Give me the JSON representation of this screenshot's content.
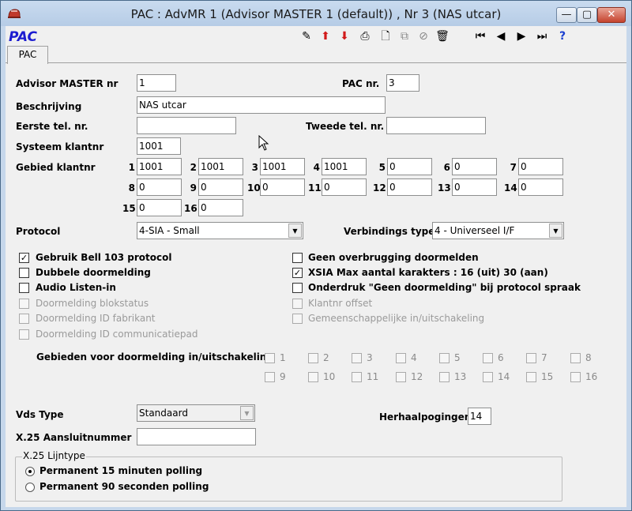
{
  "window": {
    "title": "PAC : AdvMR 1 (Advisor MASTER 1 (default)) , Nr 3 (NAS utcar)",
    "min_glyph": "—",
    "max_glyph": "▢",
    "close_glyph": "✕"
  },
  "app_logo": "PAC",
  "toolbar": {
    "icons": [
      "edit-icon",
      "up-arrow-icon",
      "down-arrow-icon",
      "print-icon",
      "new-doc-icon",
      "copy-icon",
      "cancel-icon",
      "delete-icon",
      "first-icon",
      "previous-icon",
      "next-icon",
      "last-icon",
      "help-icon"
    ],
    "glyphs": [
      "✎",
      "⬆",
      "⬇",
      "⎙",
      "🗋",
      "⧉",
      "⊘",
      "🗑",
      "⏮",
      "◀",
      "▶",
      "⏭",
      "?"
    ]
  },
  "tab": {
    "label": "PAC"
  },
  "form": {
    "advisor_master_nr_label": "Advisor MASTER nr",
    "advisor_master_nr": "1",
    "pac_nr_label": "PAC nr.",
    "pac_nr": "3",
    "beschrijving_label": "Beschrijving",
    "beschrijving": "NAS utcar",
    "eerste_tel_label": "Eerste tel. nr.",
    "eerste_tel": "",
    "tweede_tel_label": "Tweede tel. nr.",
    "tweede_tel": "",
    "systeem_klantnr_label": "Systeem klantnr",
    "systeem_klantnr": "1001",
    "gebied_klantnr_label": "Gebied klantnr",
    "gebied": [
      {
        "n": "1",
        "v": "1001"
      },
      {
        "n": "2",
        "v": "1001"
      },
      {
        "n": "3",
        "v": "1001"
      },
      {
        "n": "4",
        "v": "1001"
      },
      {
        "n": "5",
        "v": "0"
      },
      {
        "n": "6",
        "v": "0"
      },
      {
        "n": "7",
        "v": "0"
      },
      {
        "n": "8",
        "v": "0"
      },
      {
        "n": "9",
        "v": "0"
      },
      {
        "n": "10",
        "v": "0"
      },
      {
        "n": "11",
        "v": "0"
      },
      {
        "n": "12",
        "v": "0"
      },
      {
        "n": "13",
        "v": "0"
      },
      {
        "n": "14",
        "v": "0"
      },
      {
        "n": "15",
        "v": "0"
      },
      {
        "n": "16",
        "v": "0"
      }
    ],
    "protocol_label": "Protocol",
    "protocol": "4-SIA - Small",
    "verbindings_label": "Verbindings type",
    "verbindings": "4 - Universeel I/F",
    "checkboxes_left": [
      {
        "label": "Gebruik Bell 103 protocol",
        "checked": true,
        "disabled": false
      },
      {
        "label": "Dubbele doormelding",
        "checked": false,
        "disabled": false
      },
      {
        "label": "Audio Listen-in",
        "checked": false,
        "disabled": false
      },
      {
        "label": "Doormelding blokstatus",
        "checked": false,
        "disabled": true
      },
      {
        "label": "Doormelding ID fabrikant",
        "checked": false,
        "disabled": true
      },
      {
        "label": "Doormelding ID communicatiepad",
        "checked": false,
        "disabled": true
      }
    ],
    "checkboxes_right": [
      {
        "label": "Geen overbrugging doormelden",
        "checked": false,
        "disabled": false
      },
      {
        "label": "XSIA Max aantal karakters : 16 (uit) 30 (aan)",
        "checked": true,
        "disabled": false
      },
      {
        "label": "Onderdruk \"Geen doormelding\" bij protocol spraak",
        "checked": false,
        "disabled": false
      },
      {
        "label": "Klantnr offset",
        "checked": false,
        "disabled": true
      },
      {
        "label": "Gemeenschappelijke in/uitschakeling",
        "checked": false,
        "disabled": true
      }
    ],
    "gebieden_label": "Gebieden voor doormelding in/uitschakeling",
    "gebieden": [
      "1",
      "2",
      "3",
      "4",
      "5",
      "6",
      "7",
      "8",
      "9",
      "10",
      "11",
      "12",
      "13",
      "14",
      "15",
      "16"
    ],
    "check_glyph": "✓",
    "vds_type_label": "Vds Type",
    "vds_type": "Standaard",
    "herhaal_label": "Herhaalpogingen",
    "herhaal": "14",
    "x25_label": "X.25 Aansluitnummer",
    "x25": "",
    "lijntype_title": "X.25 Lijntype",
    "radios": [
      {
        "label": "Permanent 15 minuten polling",
        "selected": true
      },
      {
        "label": "Permanent 90 seconden polling",
        "selected": false
      }
    ],
    "combo_arrow": "▼"
  }
}
